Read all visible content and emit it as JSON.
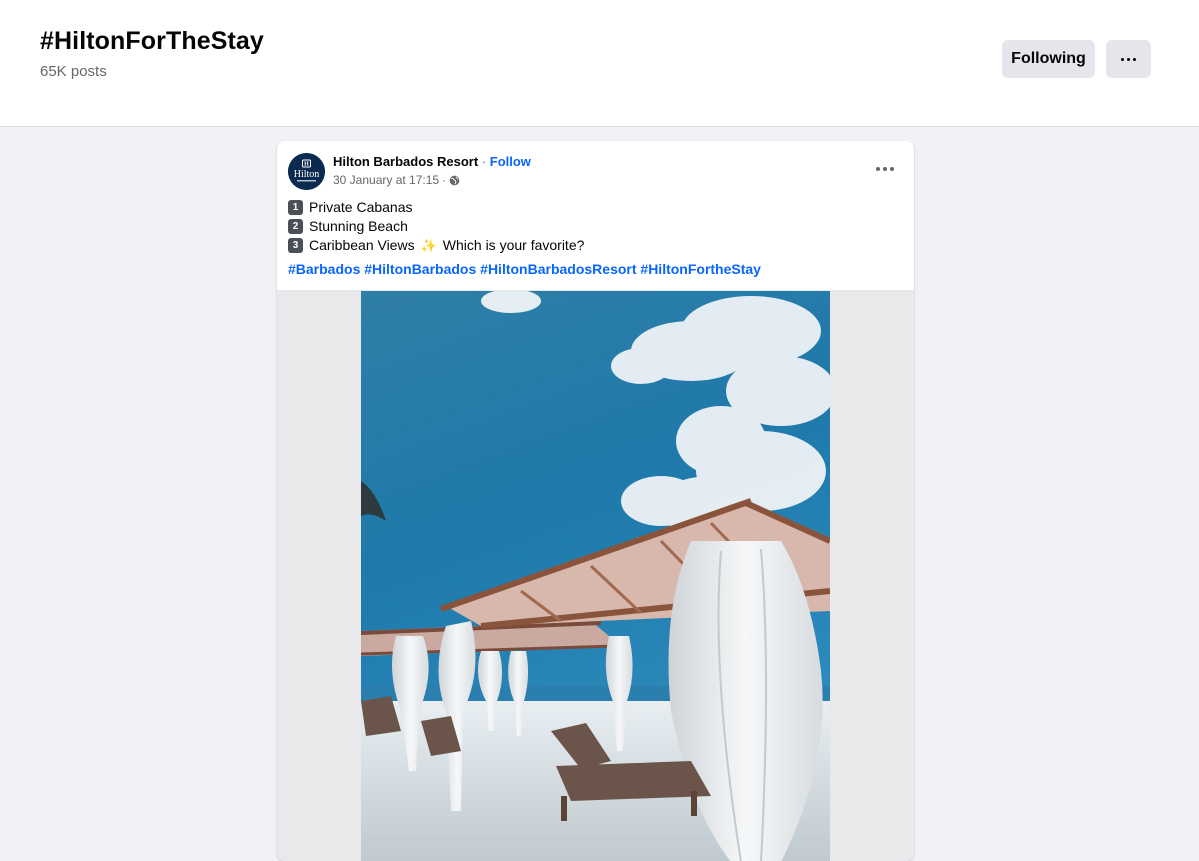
{
  "hashtag": {
    "title": "#HiltonForTheStay",
    "post_count": "65K posts",
    "following_label": "Following",
    "more_icon": "more-horizontal-icon"
  },
  "post": {
    "author": "Hilton Barbados Resort",
    "separator": " · ",
    "follow_label": "Follow",
    "timestamp": "30 January at 17:15",
    "meta_separator": " · ",
    "privacy_icon": "globe-icon",
    "avatar_icon": "hilton-logo",
    "lines": [
      {
        "number": "1",
        "text": "Private Cabanas"
      },
      {
        "number": "2",
        "text": "Stunning Beach"
      },
      {
        "number": "3",
        "text": "Caribbean Views",
        "sparkle": "✨",
        "suffix": "Which is your favorite?"
      }
    ],
    "hashtags": [
      "#Barbados",
      "#HiltonBarbados",
      "#HiltonBarbadosResort",
      "#HiltonFortheStay"
    ],
    "media_icon": "beach-cabana-photo"
  },
  "colors": {
    "link": "#0866ff",
    "background": "#f0f2f5",
    "button": "#e4e6eb"
  }
}
